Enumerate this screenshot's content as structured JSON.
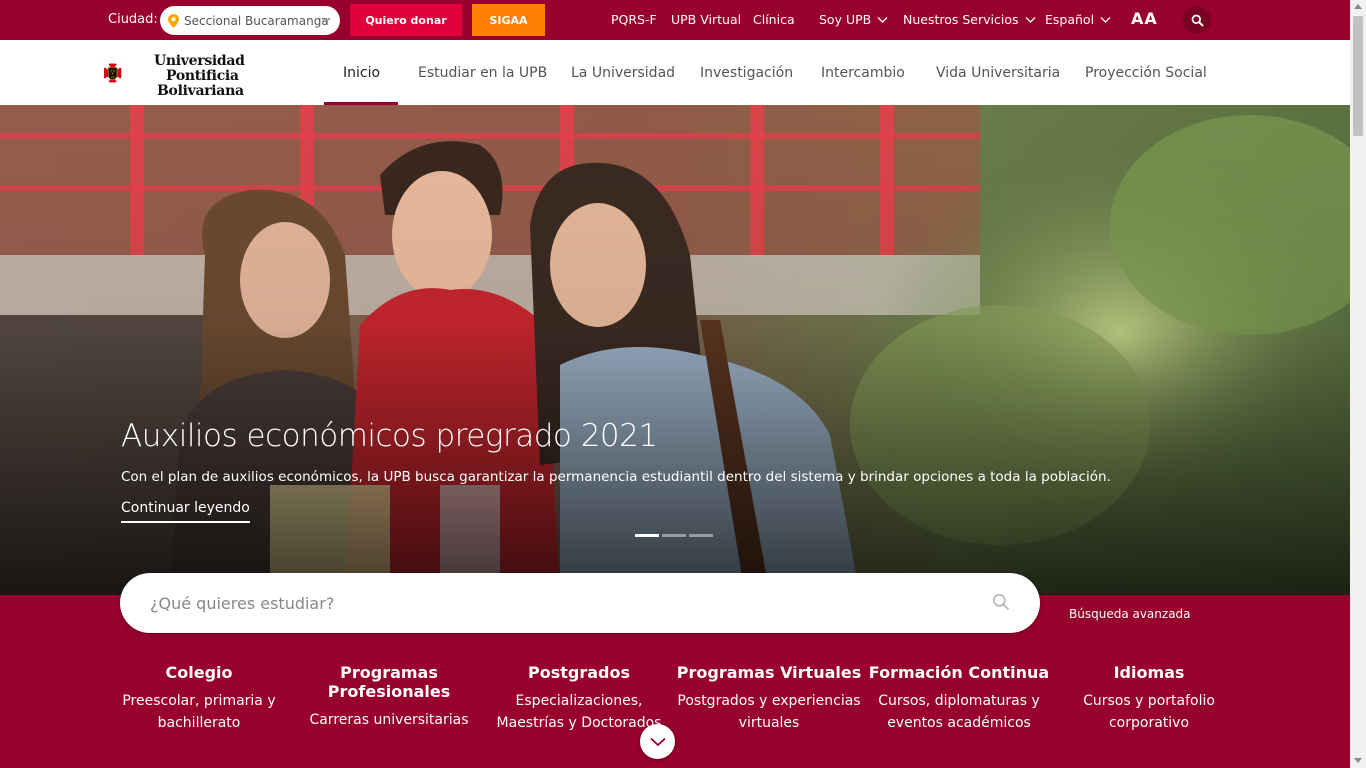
{
  "topbar": {
    "city_label": "Ciudad:",
    "city_value": "Seccional Bucaramanga",
    "donate_label": "Quiero donar",
    "sigaa_label": "SIGAA",
    "links": {
      "pqrs": "PQRS-F",
      "virtual": "UPB Virtual",
      "clinica": "Clínica",
      "soy_upb": "Soy UPB",
      "servicios": "Nuestros Servicios",
      "idioma": "Español"
    },
    "font_size_label": "AA",
    "colors": {
      "bar": "#98002e",
      "donate": "#e1003a",
      "sigaa": "#ff7f00"
    }
  },
  "logo": {
    "line1": "Universidad",
    "line2": "Pontificia",
    "line3": "Bolivariana",
    "seal_top": "Α Ω",
    "seal_mid": "☧",
    "seal_bottom": "UPB"
  },
  "nav": {
    "items": [
      {
        "label": "Inicio",
        "active": true
      },
      {
        "label": "Estudiar en la UPB"
      },
      {
        "label": "La Universidad"
      },
      {
        "label": "Investigación"
      },
      {
        "label": "Intercambio"
      },
      {
        "label": "Vida Universitaria"
      },
      {
        "label": "Proyección Social"
      }
    ]
  },
  "hero": {
    "title": "Auxilios económicos pregrado 2021",
    "description": "Con el plan de auxilios económicos, la UPB busca garantizar la permanencia estudiantil dentro del sistema y brindar opciones a toda la población.",
    "link_label": "Continuar leyendo",
    "slides": 3,
    "active_slide": 1
  },
  "search": {
    "placeholder": "¿Qué quieres estudiar?",
    "advanced_label": "Búsqueda avanzada"
  },
  "programs": [
    {
      "title": "Colegio",
      "desc": "Preescolar, primaria y bachillerato"
    },
    {
      "title": "Programas Profesionales",
      "desc": "Carreras universitarias"
    },
    {
      "title": "Postgrados",
      "desc": "Especializaciones, Maestrías y Doctorados"
    },
    {
      "title": "Programas Virtuales",
      "desc": "Postgrados y experiencias virtuales"
    },
    {
      "title": "Formación Continua",
      "desc": "Cursos, diplomaturas y eventos académicos"
    },
    {
      "title": "Idiomas",
      "desc": "Cursos y portafolio corporativo"
    }
  ]
}
